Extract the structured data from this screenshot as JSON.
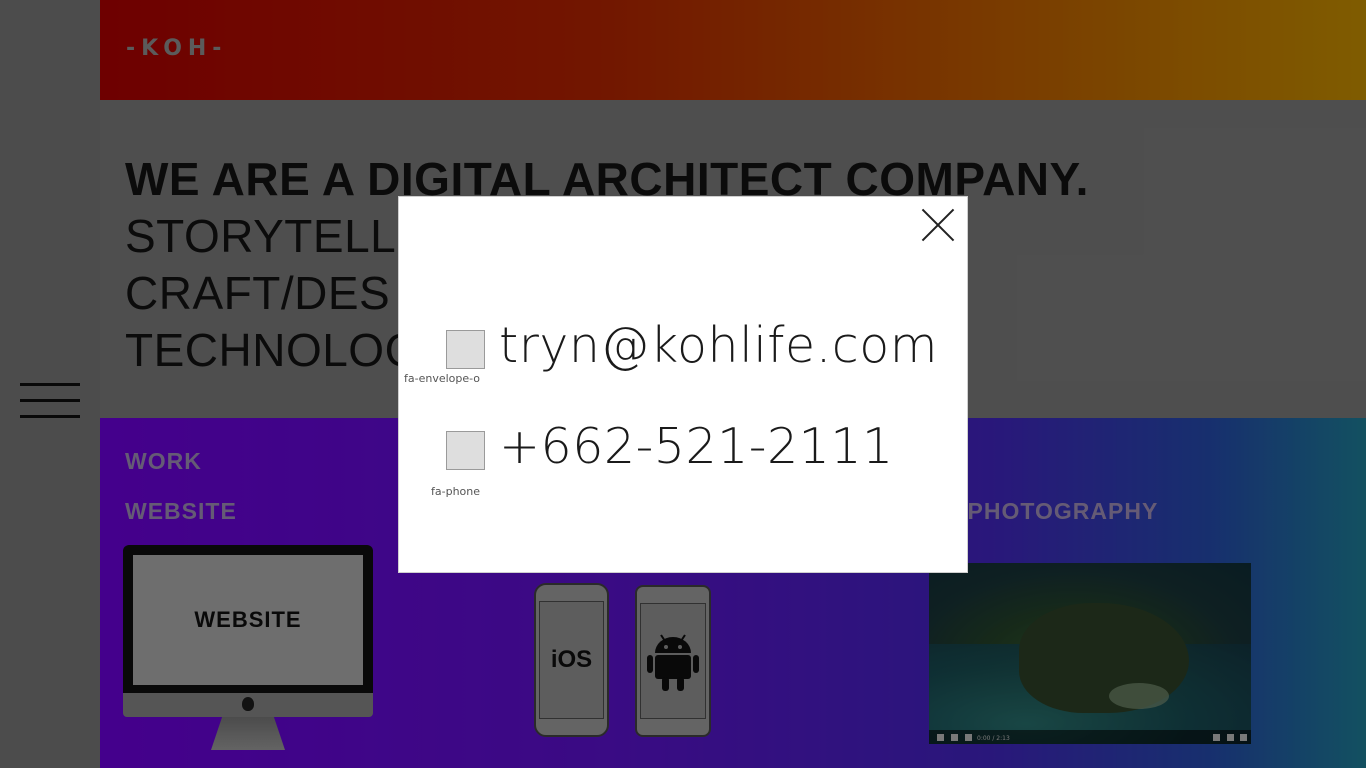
{
  "header": {
    "logo": "-KOH-"
  },
  "hero": {
    "line1": "WE ARE A DIGITAL ARCHITECT COMPANY.",
    "line2": "STORYTELLI",
    "line3": "CRAFT/DES",
    "line4": "TECHNOLOG"
  },
  "work": {
    "title": "WORK",
    "categories": [
      "WEBSITE",
      "M/PHOTOGRAPHY"
    ],
    "website_label": "WEBSITE",
    "ios_label": "iOS",
    "video_time": "0:00 / 2:13"
  },
  "modal": {
    "email_icon_label": "fa-envelope-o",
    "email": "tryn@kohlife.com",
    "phone_icon_label": "fa-phone",
    "phone": "+662-521-2111"
  },
  "colors": {
    "header_start": "#c80000",
    "header_end": "#e8a800",
    "work_start": "#7d00ff",
    "work_end": "#2393b0"
  }
}
